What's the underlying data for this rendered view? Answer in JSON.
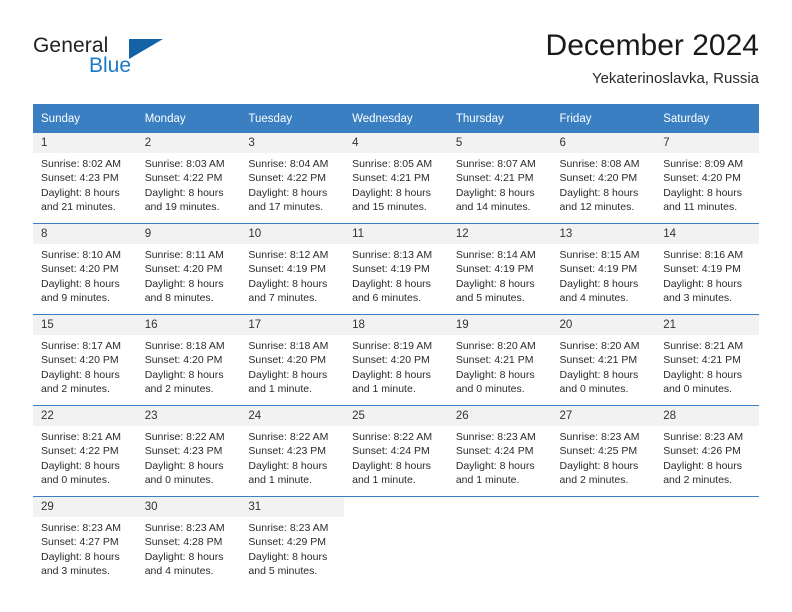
{
  "logo": {
    "word_one": "General",
    "word_two": "Blue",
    "icon": "triangle-mark",
    "blue": "#1f7ac4",
    "dark_blue": "#1462a6"
  },
  "header": {
    "title": "December 2024",
    "subtitle": "Yekaterinoslavka, Russia"
  },
  "calendar": {
    "accent_color": "#3a7fc1",
    "daynum_bg": "#f2f2f2",
    "weekday_headers": [
      "Sunday",
      "Monday",
      "Tuesday",
      "Wednesday",
      "Thursday",
      "Friday",
      "Saturday"
    ],
    "weeks": [
      [
        {
          "day": "1",
          "sunrise": "Sunrise: 8:02 AM",
          "sunset": "Sunset: 4:23 PM",
          "daylight_1": "Daylight: 8 hours",
          "daylight_2": "and 21 minutes."
        },
        {
          "day": "2",
          "sunrise": "Sunrise: 8:03 AM",
          "sunset": "Sunset: 4:22 PM",
          "daylight_1": "Daylight: 8 hours",
          "daylight_2": "and 19 minutes."
        },
        {
          "day": "3",
          "sunrise": "Sunrise: 8:04 AM",
          "sunset": "Sunset: 4:22 PM",
          "daylight_1": "Daylight: 8 hours",
          "daylight_2": "and 17 minutes."
        },
        {
          "day": "4",
          "sunrise": "Sunrise: 8:05 AM",
          "sunset": "Sunset: 4:21 PM",
          "daylight_1": "Daylight: 8 hours",
          "daylight_2": "and 15 minutes."
        },
        {
          "day": "5",
          "sunrise": "Sunrise: 8:07 AM",
          "sunset": "Sunset: 4:21 PM",
          "daylight_1": "Daylight: 8 hours",
          "daylight_2": "and 14 minutes."
        },
        {
          "day": "6",
          "sunrise": "Sunrise: 8:08 AM",
          "sunset": "Sunset: 4:20 PM",
          "daylight_1": "Daylight: 8 hours",
          "daylight_2": "and 12 minutes."
        },
        {
          "day": "7",
          "sunrise": "Sunrise: 8:09 AM",
          "sunset": "Sunset: 4:20 PM",
          "daylight_1": "Daylight: 8 hours",
          "daylight_2": "and 11 minutes."
        }
      ],
      [
        {
          "day": "8",
          "sunrise": "Sunrise: 8:10 AM",
          "sunset": "Sunset: 4:20 PM",
          "daylight_1": "Daylight: 8 hours",
          "daylight_2": "and 9 minutes."
        },
        {
          "day": "9",
          "sunrise": "Sunrise: 8:11 AM",
          "sunset": "Sunset: 4:20 PM",
          "daylight_1": "Daylight: 8 hours",
          "daylight_2": "and 8 minutes."
        },
        {
          "day": "10",
          "sunrise": "Sunrise: 8:12 AM",
          "sunset": "Sunset: 4:19 PM",
          "daylight_1": "Daylight: 8 hours",
          "daylight_2": "and 7 minutes."
        },
        {
          "day": "11",
          "sunrise": "Sunrise: 8:13 AM",
          "sunset": "Sunset: 4:19 PM",
          "daylight_1": "Daylight: 8 hours",
          "daylight_2": "and 6 minutes."
        },
        {
          "day": "12",
          "sunrise": "Sunrise: 8:14 AM",
          "sunset": "Sunset: 4:19 PM",
          "daylight_1": "Daylight: 8 hours",
          "daylight_2": "and 5 minutes."
        },
        {
          "day": "13",
          "sunrise": "Sunrise: 8:15 AM",
          "sunset": "Sunset: 4:19 PM",
          "daylight_1": "Daylight: 8 hours",
          "daylight_2": "and 4 minutes."
        },
        {
          "day": "14",
          "sunrise": "Sunrise: 8:16 AM",
          "sunset": "Sunset: 4:19 PM",
          "daylight_1": "Daylight: 8 hours",
          "daylight_2": "and 3 minutes."
        }
      ],
      [
        {
          "day": "15",
          "sunrise": "Sunrise: 8:17 AM",
          "sunset": "Sunset: 4:20 PM",
          "daylight_1": "Daylight: 8 hours",
          "daylight_2": "and 2 minutes."
        },
        {
          "day": "16",
          "sunrise": "Sunrise: 8:18 AM",
          "sunset": "Sunset: 4:20 PM",
          "daylight_1": "Daylight: 8 hours",
          "daylight_2": "and 2 minutes."
        },
        {
          "day": "17",
          "sunrise": "Sunrise: 8:18 AM",
          "sunset": "Sunset: 4:20 PM",
          "daylight_1": "Daylight: 8 hours",
          "daylight_2": "and 1 minute."
        },
        {
          "day": "18",
          "sunrise": "Sunrise: 8:19 AM",
          "sunset": "Sunset: 4:20 PM",
          "daylight_1": "Daylight: 8 hours",
          "daylight_2": "and 1 minute."
        },
        {
          "day": "19",
          "sunrise": "Sunrise: 8:20 AM",
          "sunset": "Sunset: 4:21 PM",
          "daylight_1": "Daylight: 8 hours",
          "daylight_2": "and 0 minutes."
        },
        {
          "day": "20",
          "sunrise": "Sunrise: 8:20 AM",
          "sunset": "Sunset: 4:21 PM",
          "daylight_1": "Daylight: 8 hours",
          "daylight_2": "and 0 minutes."
        },
        {
          "day": "21",
          "sunrise": "Sunrise: 8:21 AM",
          "sunset": "Sunset: 4:21 PM",
          "daylight_1": "Daylight: 8 hours",
          "daylight_2": "and 0 minutes."
        }
      ],
      [
        {
          "day": "22",
          "sunrise": "Sunrise: 8:21 AM",
          "sunset": "Sunset: 4:22 PM",
          "daylight_1": "Daylight: 8 hours",
          "daylight_2": "and 0 minutes."
        },
        {
          "day": "23",
          "sunrise": "Sunrise: 8:22 AM",
          "sunset": "Sunset: 4:23 PM",
          "daylight_1": "Daylight: 8 hours",
          "daylight_2": "and 0 minutes."
        },
        {
          "day": "24",
          "sunrise": "Sunrise: 8:22 AM",
          "sunset": "Sunset: 4:23 PM",
          "daylight_1": "Daylight: 8 hours",
          "daylight_2": "and 1 minute."
        },
        {
          "day": "25",
          "sunrise": "Sunrise: 8:22 AM",
          "sunset": "Sunset: 4:24 PM",
          "daylight_1": "Daylight: 8 hours",
          "daylight_2": "and 1 minute."
        },
        {
          "day": "26",
          "sunrise": "Sunrise: 8:23 AM",
          "sunset": "Sunset: 4:24 PM",
          "daylight_1": "Daylight: 8 hours",
          "daylight_2": "and 1 minute."
        },
        {
          "day": "27",
          "sunrise": "Sunrise: 8:23 AM",
          "sunset": "Sunset: 4:25 PM",
          "daylight_1": "Daylight: 8 hours",
          "daylight_2": "and 2 minutes."
        },
        {
          "day": "28",
          "sunrise": "Sunrise: 8:23 AM",
          "sunset": "Sunset: 4:26 PM",
          "daylight_1": "Daylight: 8 hours",
          "daylight_2": "and 2 minutes."
        }
      ],
      [
        {
          "day": "29",
          "sunrise": "Sunrise: 8:23 AM",
          "sunset": "Sunset: 4:27 PM",
          "daylight_1": "Daylight: 8 hours",
          "daylight_2": "and 3 minutes."
        },
        {
          "day": "30",
          "sunrise": "Sunrise: 8:23 AM",
          "sunset": "Sunset: 4:28 PM",
          "daylight_1": "Daylight: 8 hours",
          "daylight_2": "and 4 minutes."
        },
        {
          "day": "31",
          "sunrise": "Sunrise: 8:23 AM",
          "sunset": "Sunset: 4:29 PM",
          "daylight_1": "Daylight: 8 hours",
          "daylight_2": "and 5 minutes."
        },
        {
          "day": "",
          "sunrise": "",
          "sunset": "",
          "daylight_1": "",
          "daylight_2": ""
        },
        {
          "day": "",
          "sunrise": "",
          "sunset": "",
          "daylight_1": "",
          "daylight_2": ""
        },
        {
          "day": "",
          "sunrise": "",
          "sunset": "",
          "daylight_1": "",
          "daylight_2": ""
        },
        {
          "day": "",
          "sunrise": "",
          "sunset": "",
          "daylight_1": "",
          "daylight_2": ""
        }
      ]
    ]
  }
}
